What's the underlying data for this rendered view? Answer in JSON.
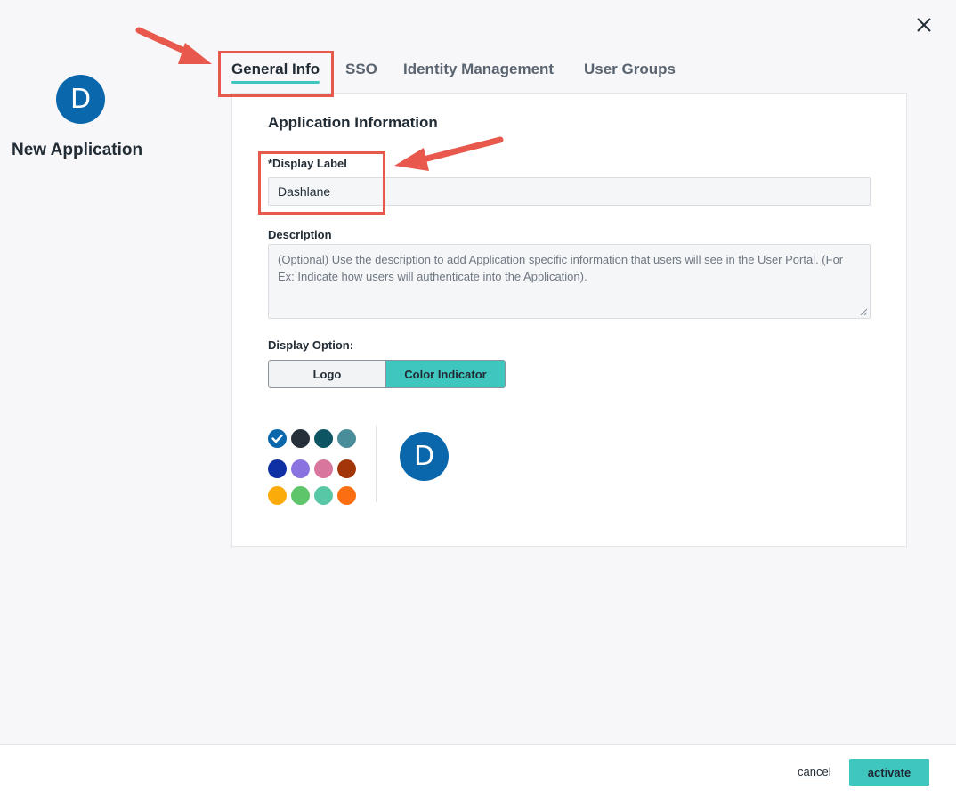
{
  "application": {
    "avatar_letter": "D",
    "name": "New Application"
  },
  "tabs": [
    {
      "label": "General Info",
      "active": true
    },
    {
      "label": "SSO",
      "active": false
    },
    {
      "label": "Identity Management",
      "active": false
    },
    {
      "label": "User Groups",
      "active": false
    }
  ],
  "form": {
    "section_title": "Application Information",
    "display_label": {
      "label": "*Display Label",
      "value": "Dashlane"
    },
    "description": {
      "label": "Description",
      "placeholder": "(Optional) Use the description to add Application specific information that users will see in the User Portal. (For Ex: Indicate how users will authenticate into the Application)."
    },
    "display_option": {
      "label": "Display Option:",
      "options": [
        "Logo",
        "Color Indicator"
      ],
      "selected": "Color Indicator"
    },
    "colors": [
      {
        "hex": "#0a67ac",
        "selected": true
      },
      {
        "hex": "#26303b",
        "selected": false
      },
      {
        "hex": "#0e5563",
        "selected": false
      },
      {
        "hex": "#4a8d9a",
        "selected": false
      },
      {
        "hex": "#0f2fa5",
        "selected": false
      },
      {
        "hex": "#8a72e0",
        "selected": false
      },
      {
        "hex": "#d9769e",
        "selected": false
      },
      {
        "hex": "#a23608",
        "selected": false
      },
      {
        "hex": "#fbac08",
        "selected": false
      },
      {
        "hex": "#5fc56a",
        "selected": false
      },
      {
        "hex": "#58c7a6",
        "selected": false
      },
      {
        "hex": "#fb6f12",
        "selected": false
      }
    ],
    "preview_letter": "D"
  },
  "footer": {
    "cancel_label": "cancel",
    "activate_label": "activate"
  },
  "theme": {
    "accent": "#3ec6bf",
    "avatar_color": "#0a67ac",
    "annotation_color": "#e8584d"
  },
  "icons": {
    "close": "close-icon",
    "check": "check-icon"
  }
}
